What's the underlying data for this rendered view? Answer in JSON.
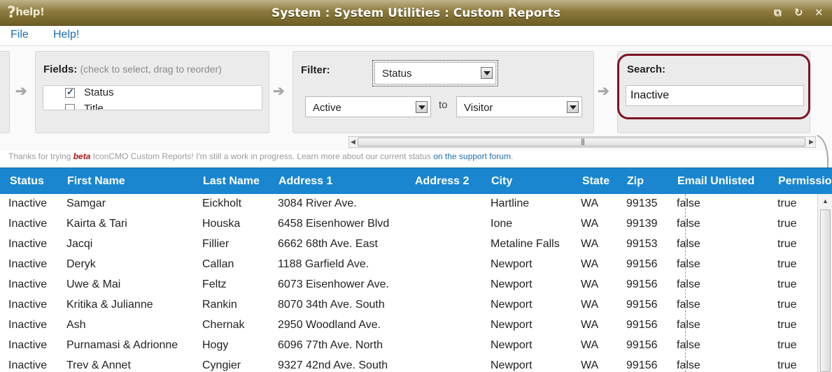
{
  "window": {
    "help_logo": "help!",
    "title": "System : System Utilities : Custom Reports",
    "controls": {
      "restore": "⧉",
      "refresh": "↻",
      "close": "✕"
    }
  },
  "menu": {
    "file": "File",
    "help": "Help!"
  },
  "fields_panel": {
    "title": "Fields:",
    "hint": "(check to select, drag to reorder)",
    "items": [
      {
        "label": "Status",
        "checked": true
      },
      {
        "label": "Title",
        "checked": false
      }
    ]
  },
  "filter_panel": {
    "title": "Filter:",
    "field_select": "Status",
    "from_select": "Active",
    "to_label": "to",
    "to_select": "Visitor"
  },
  "search_panel": {
    "title": "Search:",
    "value": "Inactive"
  },
  "beta_note": {
    "prefix": "Thanks for trying ",
    "beta": "beta",
    "middle": " IconCMO Custom Reports! I'm still a work in progress. Learn more about our current status ",
    "link": "on the support forum",
    "suffix": "."
  },
  "table": {
    "headers": [
      "Status",
      "First Name",
      "Last Name",
      "Address 1",
      "Address 2",
      "City",
      "State",
      "Zip",
      "Email Unlisted",
      "Permissio"
    ],
    "rows": [
      [
        "Inactive",
        "Samgar",
        "Eickholt",
        "3084 River Ave.",
        "",
        "Hartline",
        "WA",
        "99135",
        "false",
        "true"
      ],
      [
        "Inactive",
        "Kairta & Tari",
        "Houska",
        "6458 Eisenhower Blvd",
        "",
        "Ione",
        "WA",
        "99139",
        "false",
        "true"
      ],
      [
        "Inactive",
        "Jacqi",
        "Fillier",
        "6662 68th Ave. East",
        "",
        "Metaline Falls",
        "WA",
        "99153",
        "false",
        "true"
      ],
      [
        "Inactive",
        "Deryk",
        "Callan",
        "1188 Garfield Ave.",
        "",
        "Newport",
        "WA",
        "99156",
        "false",
        "true"
      ],
      [
        "Inactive",
        "Uwe & Mai",
        "Feltz",
        "6073 Eisenhower Ave.",
        "",
        "Newport",
        "WA",
        "99156",
        "false",
        "true"
      ],
      [
        "Inactive",
        "Kritika & Julianne",
        "Rankin",
        "8070 34th Ave. South",
        "",
        "Newport",
        "WA",
        "99156",
        "false",
        "true"
      ],
      [
        "Inactive",
        "Ash",
        "Chernak",
        "2950 Woodland Ave.",
        "",
        "Newport",
        "WA",
        "99156",
        "false",
        "true"
      ],
      [
        "Inactive",
        "Purnamasi & Adrionne",
        "Hogy",
        "6096 77th Ave. North",
        "",
        "Newport",
        "WA",
        "99156",
        "false",
        "true"
      ],
      [
        "Inactive",
        "Trev & Annet",
        "Cyngier",
        "9327 42nd Ave. South",
        "",
        "Newport",
        "WA",
        "99156",
        "false",
        "true"
      ]
    ]
  },
  "colors": {
    "titlebar": "#8c7a3d",
    "header_blue": "#1a86d0",
    "highlight_ring": "#7d1426",
    "link_blue": "#1a6fb5"
  }
}
